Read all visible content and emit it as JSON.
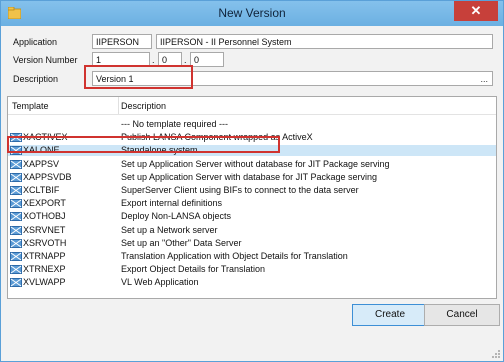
{
  "window": {
    "title": "New Version",
    "close_label": "✕"
  },
  "form": {
    "application_label": "Application",
    "application_code": "IIPERSON",
    "application_name": "IIPERSON - II Personnel System",
    "version_number_label": "Version Number",
    "version_major": "1",
    "version_minor": "0",
    "version_patch": "0",
    "description_label": "Description",
    "description_value": "Version 1",
    "description_more": "..."
  },
  "list": {
    "columns": [
      "Template",
      "Description"
    ],
    "rows": [
      {
        "template": "",
        "description": "--- No template required ---",
        "icon": false,
        "selected": false
      },
      {
        "template": "XACTIVEX",
        "description": "Publish LANSA Component wrapped as ActiveX",
        "icon": true,
        "selected": false
      },
      {
        "template": "XALONE",
        "description": "Standalone system",
        "icon": true,
        "selected": true
      },
      {
        "template": "XAPPSV",
        "description": "Set up Application Server without database for JIT Package serving",
        "icon": true,
        "selected": false
      },
      {
        "template": "XAPPSVDB",
        "description": "Set up Application Server with database for JIT Package serving",
        "icon": true,
        "selected": false
      },
      {
        "template": "XCLTBIF",
        "description": "SuperServer Client using BIFs to connect to the data server",
        "icon": true,
        "selected": false
      },
      {
        "template": "XEXPORT",
        "description": "Export internal definitions",
        "icon": true,
        "selected": false
      },
      {
        "template": "XOTHOBJ",
        "description": "Deploy Non-LANSA objects",
        "icon": true,
        "selected": false
      },
      {
        "template": "XSRVNET",
        "description": "Set up a Network server",
        "icon": true,
        "selected": false
      },
      {
        "template": "XSRVOTH",
        "description": "Set up an \"Other\" Data Server",
        "icon": true,
        "selected": false
      },
      {
        "template": "XTRNAPP",
        "description": "Translation Application with Object Details for Translation",
        "icon": true,
        "selected": false
      },
      {
        "template": "XTRNEXP",
        "description": "Export Object Details for Translation",
        "icon": true,
        "selected": false
      },
      {
        "template": "XVLWAPP",
        "description": "VL Web Application",
        "icon": true,
        "selected": false
      }
    ]
  },
  "buttons": {
    "create": "Create",
    "cancel": "Cancel"
  },
  "colors": {
    "titlebar": "#6cb0e2",
    "highlight": "#d0332f",
    "selection": "#cde6f7",
    "close": "#c7403a"
  }
}
